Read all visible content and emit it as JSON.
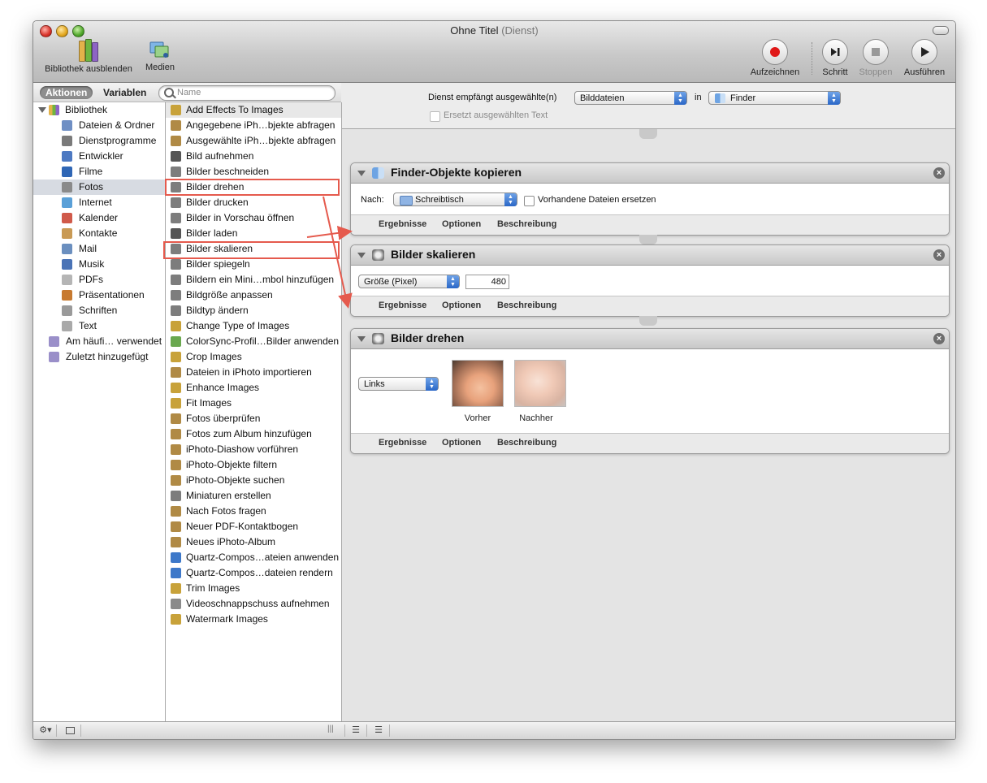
{
  "window": {
    "title": "Ohne Titel",
    "subtitle": "(Dienst)"
  },
  "toolbar": {
    "library_toggle": "Bibliothek ausblenden",
    "media": "Medien",
    "record": "Aufzeichnen",
    "step": "Schritt",
    "stop": "Stoppen",
    "run": "Ausführen"
  },
  "segments": {
    "actions": "Aktionen",
    "variables": "Variablen"
  },
  "search": {
    "placeholder": "Name"
  },
  "library": {
    "root": "Bibliothek",
    "items": [
      {
        "label": "Dateien & Ordner",
        "icon": "folder-icon",
        "color": "#6f8fc4"
      },
      {
        "label": "Dienstprogramme",
        "icon": "utilities-icon",
        "color": "#7a7a7a"
      },
      {
        "label": "Entwickler",
        "icon": "developer-icon",
        "color": "#4d79c2"
      },
      {
        "label": "Filme",
        "icon": "film-icon",
        "color": "#2f66b5"
      },
      {
        "label": "Fotos",
        "icon": "photos-icon",
        "color": "#8a8a8a"
      },
      {
        "label": "Internet",
        "icon": "globe-icon",
        "color": "#5aa0d8"
      },
      {
        "label": "Kalender",
        "icon": "calendar-icon",
        "color": "#d05a4a"
      },
      {
        "label": "Kontakte",
        "icon": "contacts-icon",
        "color": "#c99a55"
      },
      {
        "label": "Mail",
        "icon": "mail-icon",
        "color": "#6b8fbf"
      },
      {
        "label": "Musik",
        "icon": "music-icon",
        "color": "#4a73b6"
      },
      {
        "label": "PDFs",
        "icon": "pdf-icon",
        "color": "#b5b5b5"
      },
      {
        "label": "Präsentationen",
        "icon": "presentation-icon",
        "color": "#c77a30"
      },
      {
        "label": "Schriften",
        "icon": "fonts-icon",
        "color": "#9a9a9a"
      },
      {
        "label": "Text",
        "icon": "text-icon",
        "color": "#a9a9a9"
      }
    ],
    "smart": [
      {
        "label": "Am häufi… verwendet",
        "icon": "smart-folder-icon",
        "color": "#9a8fc9"
      },
      {
        "label": "Zuletzt hinzugefügt",
        "icon": "smart-folder-icon",
        "color": "#9a8fc9"
      }
    ]
  },
  "actions": [
    {
      "label": "Add Effects To Images",
      "color": "#c8a23a"
    },
    {
      "label": "Angegebene iPh…bjekte abfragen",
      "color": "#b08a45"
    },
    {
      "label": "Ausgewählte iPh…bjekte abfragen",
      "color": "#b08a45"
    },
    {
      "label": "Bild aufnehmen",
      "color": "#555555"
    },
    {
      "label": "Bilder beschneiden",
      "color": "#7d7d7d"
    },
    {
      "label": "Bilder drehen",
      "color": "#7d7d7d"
    },
    {
      "label": "Bilder drucken",
      "color": "#7d7d7d"
    },
    {
      "label": "Bilder in Vorschau öffnen",
      "color": "#7d7d7d"
    },
    {
      "label": "Bilder laden",
      "color": "#555555"
    },
    {
      "label": "Bilder skalieren",
      "color": "#7d7d7d"
    },
    {
      "label": "Bilder spiegeln",
      "color": "#7d7d7d"
    },
    {
      "label": "Bildern ein Mini…mbol hinzufügen",
      "color": "#7d7d7d"
    },
    {
      "label": "Bildgröße anpassen",
      "color": "#7d7d7d"
    },
    {
      "label": "Bildtyp ändern",
      "color": "#7d7d7d"
    },
    {
      "label": "Change Type of Images",
      "color": "#c8a23a"
    },
    {
      "label": "ColorSync-Profil…Bilder anwenden",
      "color": "#6aa84f"
    },
    {
      "label": "Crop Images",
      "color": "#c8a23a"
    },
    {
      "label": "Dateien in iPhoto importieren",
      "color": "#b08a45"
    },
    {
      "label": "Enhance Images",
      "color": "#c8a23a"
    },
    {
      "label": "Fit Images",
      "color": "#c8a23a"
    },
    {
      "label": "Fotos überprüfen",
      "color": "#b08a45"
    },
    {
      "label": "Fotos zum Album hinzufügen",
      "color": "#b08a45"
    },
    {
      "label": "iPhoto-Diashow vorführen",
      "color": "#b08a45"
    },
    {
      "label": "iPhoto-Objekte filtern",
      "color": "#b08a45"
    },
    {
      "label": "iPhoto-Objekte suchen",
      "color": "#b08a45"
    },
    {
      "label": "Miniaturen erstellen",
      "color": "#7d7d7d"
    },
    {
      "label": "Nach Fotos fragen",
      "color": "#b08a45"
    },
    {
      "label": "Neuer PDF-Kontaktbogen",
      "color": "#b08a45"
    },
    {
      "label": "Neues iPhoto-Album",
      "color": "#b08a45"
    },
    {
      "label": "Quartz-Compos…ateien anwenden",
      "color": "#3d78c9"
    },
    {
      "label": "Quartz-Compos…dateien rendern",
      "color": "#3d78c9"
    },
    {
      "label": "Trim Images",
      "color": "#c8a23a"
    },
    {
      "label": "Videoschnappschuss aufnehmen",
      "color": "#8a8a8a"
    },
    {
      "label": "Watermark Images",
      "color": "#c8a23a"
    }
  ],
  "service": {
    "receives_label": "Dienst empfängt ausgewählte(n)",
    "receives_value": "Bilddateien",
    "in_label": "in",
    "in_value": "Finder",
    "replace_label": "Ersetzt ausgewählten Text"
  },
  "panels": [
    {
      "title": "Finder-Objekte kopieren",
      "to_label": "Nach:",
      "to_value": "Schreibtisch",
      "replace_label": "Vorhandene Dateien ersetzen"
    },
    {
      "title": "Bilder skalieren",
      "mode_value": "Größe (Pixel)",
      "size_value": "480"
    },
    {
      "title": "Bilder drehen",
      "direction_value": "Links",
      "before_label": "Vorher",
      "after_label": "Nachher"
    }
  ],
  "footer_tabs": {
    "results": "Ergebnisse",
    "options": "Optionen",
    "description": "Beschreibung"
  },
  "bottom": {
    "gear": "⚙▾",
    "grip": "|||"
  }
}
